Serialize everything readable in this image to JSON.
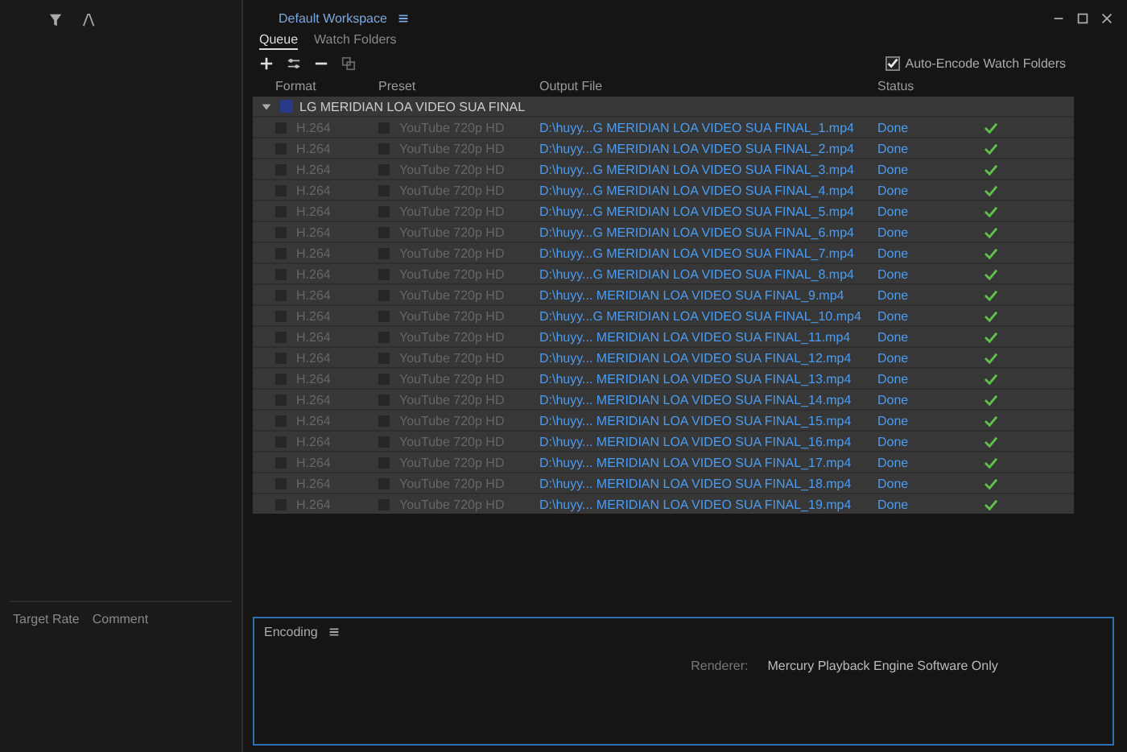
{
  "workspace": {
    "title": "Default Workspace"
  },
  "left_panel": {
    "columns": [
      "Target Rate",
      "Comment"
    ]
  },
  "queue": {
    "tabs": [
      {
        "label": "Queue",
        "selected": true
      },
      {
        "label": "Watch Folders",
        "selected": false
      }
    ],
    "auto_encode": {
      "label": "Auto-Encode Watch Folders",
      "checked": true
    },
    "columns": [
      "Format",
      "Preset",
      "Output File",
      "Status"
    ],
    "group": "LG MERIDIAN LOA VIDEO SUA FINAL",
    "items": [
      {
        "format": "H.264",
        "preset": "YouTube 720p HD",
        "output": "D:\\huyy...G MERIDIAN LOA VIDEO SUA FINAL_1.mp4",
        "status": "Done",
        "done": true
      },
      {
        "format": "H.264",
        "preset": "YouTube 720p HD",
        "output": "D:\\huyy...G MERIDIAN LOA VIDEO SUA FINAL_2.mp4",
        "status": "Done",
        "done": true
      },
      {
        "format": "H.264",
        "preset": "YouTube 720p HD",
        "output": "D:\\huyy...G MERIDIAN LOA VIDEO SUA FINAL_3.mp4",
        "status": "Done",
        "done": true
      },
      {
        "format": "H.264",
        "preset": "YouTube 720p HD",
        "output": "D:\\huyy...G MERIDIAN LOA VIDEO SUA FINAL_4.mp4",
        "status": "Done",
        "done": true
      },
      {
        "format": "H.264",
        "preset": "YouTube 720p HD",
        "output": "D:\\huyy...G MERIDIAN LOA VIDEO SUA FINAL_5.mp4",
        "status": "Done",
        "done": true
      },
      {
        "format": "H.264",
        "preset": "YouTube 720p HD",
        "output": "D:\\huyy...G MERIDIAN LOA VIDEO SUA FINAL_6.mp4",
        "status": "Done",
        "done": true
      },
      {
        "format": "H.264",
        "preset": "YouTube 720p HD",
        "output": "D:\\huyy...G MERIDIAN LOA VIDEO SUA FINAL_7.mp4",
        "status": "Done",
        "done": true
      },
      {
        "format": "H.264",
        "preset": "YouTube 720p HD",
        "output": "D:\\huyy...G MERIDIAN LOA VIDEO SUA FINAL_8.mp4",
        "status": "Done",
        "done": true
      },
      {
        "format": "H.264",
        "preset": "YouTube 720p HD",
        "output": "D:\\huyy... MERIDIAN LOA VIDEO SUA FINAL_9.mp4",
        "status": "Done",
        "done": true
      },
      {
        "format": "H.264",
        "preset": "YouTube 720p HD",
        "output": "D:\\huyy...G MERIDIAN LOA VIDEO SUA FINAL_10.mp4",
        "status": "Done",
        "done": true
      },
      {
        "format": "H.264",
        "preset": "YouTube 720p HD",
        "output": "D:\\huyy... MERIDIAN LOA VIDEO SUA FINAL_11.mp4",
        "status": "Done",
        "done": true
      },
      {
        "format": "H.264",
        "preset": "YouTube 720p HD",
        "output": "D:\\huyy... MERIDIAN LOA VIDEO SUA FINAL_12.mp4",
        "status": "Done",
        "done": true
      },
      {
        "format": "H.264",
        "preset": "YouTube 720p HD",
        "output": "D:\\huyy... MERIDIAN LOA VIDEO SUA FINAL_13.mp4",
        "status": "Done",
        "done": true
      },
      {
        "format": "H.264",
        "preset": "YouTube 720p HD",
        "output": "D:\\huyy... MERIDIAN LOA VIDEO SUA FINAL_14.mp4",
        "status": "Done",
        "done": true
      },
      {
        "format": "H.264",
        "preset": "YouTube 720p HD",
        "output": "D:\\huyy... MERIDIAN LOA VIDEO SUA FINAL_15.mp4",
        "status": "Done",
        "done": true
      },
      {
        "format": "H.264",
        "preset": "YouTube 720p HD",
        "output": "D:\\huyy... MERIDIAN LOA VIDEO SUA FINAL_16.mp4",
        "status": "Done",
        "done": true
      },
      {
        "format": "H.264",
        "preset": "YouTube 720p HD",
        "output": "D:\\huyy... MERIDIAN LOA VIDEO SUA FINAL_17.mp4",
        "status": "Done",
        "done": true
      },
      {
        "format": "H.264",
        "preset": "YouTube 720p HD",
        "output": "D:\\huyy... MERIDIAN LOA VIDEO SUA FINAL_18.mp4",
        "status": "Done",
        "done": true
      },
      {
        "format": "H.264",
        "preset": "YouTube 720p HD",
        "output": "D:\\huyy... MERIDIAN LOA VIDEO SUA FINAL_19.mp4",
        "status": "Done",
        "done": true
      }
    ]
  },
  "encoding": {
    "title": "Encoding",
    "renderer_label": "Renderer:",
    "renderer": "Mercury Playback Engine Software Only"
  }
}
